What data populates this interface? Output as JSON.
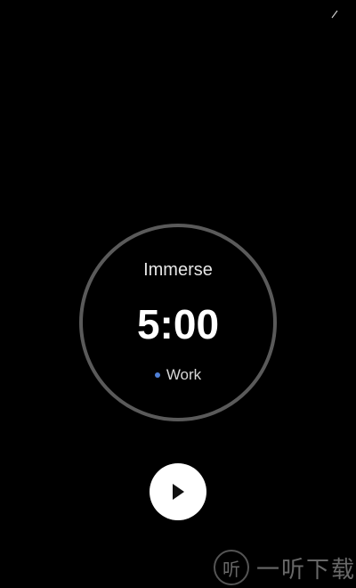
{
  "timer": {
    "mode_label": "Immerse",
    "time_display": "5:00",
    "task_label": "Work",
    "task_color": "#4f7fd6",
    "ring_color": "#5a5a5a"
  },
  "controls": {
    "play_icon": "play-icon"
  },
  "watermark": {
    "badge_glyph": "听",
    "text": "一听下载"
  },
  "colors": {
    "background": "#000000",
    "text": "#ffffff"
  }
}
